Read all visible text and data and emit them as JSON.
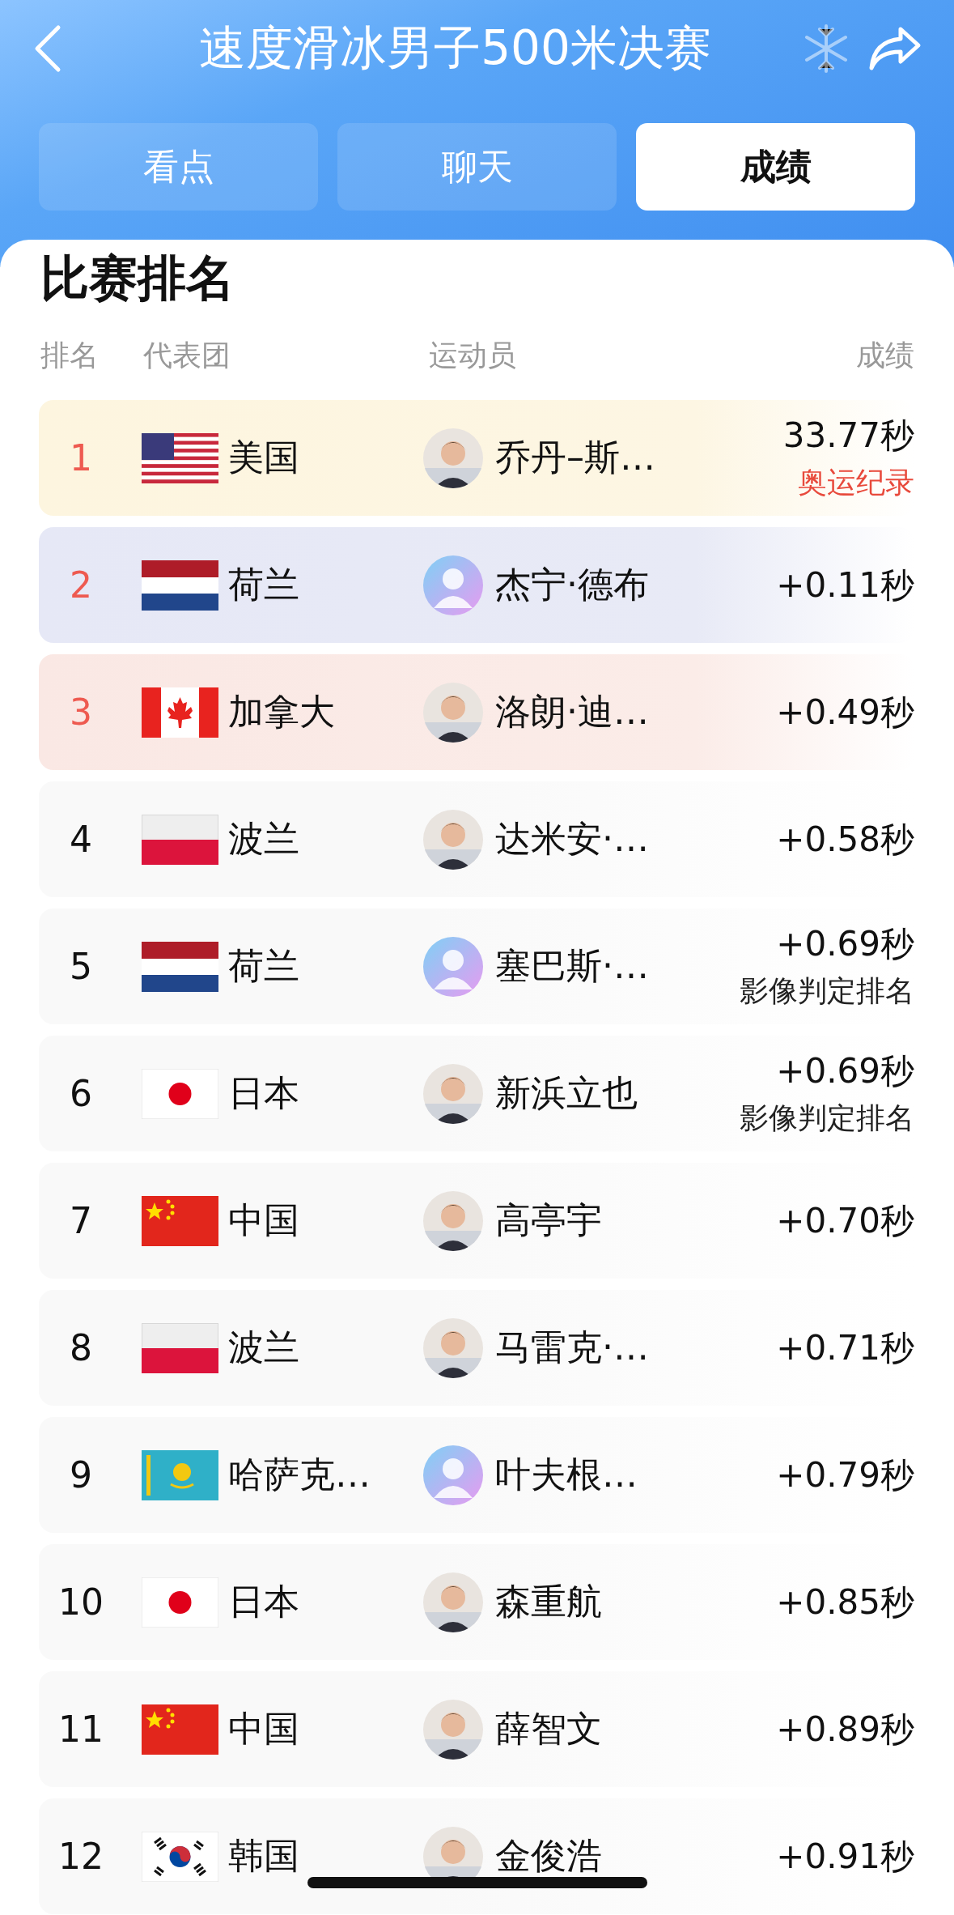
{
  "header": {
    "title": "速度滑冰男子500米决赛"
  },
  "tabs": [
    {
      "label": "看点",
      "selected": false
    },
    {
      "label": "聊天",
      "selected": false
    },
    {
      "label": "成绩",
      "selected": true
    }
  ],
  "section_title": "比赛排名",
  "columns": [
    "排名",
    "代表团",
    "运动员",
    "成绩"
  ],
  "rows": [
    {
      "rank": "1",
      "kind": "gold",
      "flag": {
        "kind": "usa"
      },
      "country": "美国",
      "athlete": "乔丹–斯…",
      "result": "33.77秒",
      "note": {
        "text": "奥运纪录",
        "kind": "record"
      }
    },
    {
      "rank": "2",
      "kind": "silver",
      "flag": {
        "kind": "netherlands"
      },
      "country": "荷兰",
      "avatar": {
        "kind": "placeholder"
      },
      "athlete": "杰宁·德布",
      "result": "+0.11秒"
    },
    {
      "rank": "3",
      "kind": "bronze",
      "flag": {
        "kind": "canada"
      },
      "country": "加拿大",
      "athlete": "洛朗·迪…",
      "result": "+0.49秒"
    },
    {
      "rank": "4",
      "kind": "plain",
      "flag": {
        "kind": "poland"
      },
      "country": "波兰",
      "athlete": "达米安·…",
      "result": "+0.58秒"
    },
    {
      "rank": "5",
      "kind": "plain",
      "flag": {
        "kind": "netherlands"
      },
      "country": "荷兰",
      "avatar": {
        "kind": "placeholder"
      },
      "athlete": "塞巴斯·…",
      "result": "+0.69秒",
      "note": {
        "text": "影像判定排名",
        "kind": "info"
      }
    },
    {
      "rank": "6",
      "kind": "plain",
      "flag": {
        "kind": "japan"
      },
      "country": "日本",
      "athlete": "新浜立也",
      "result": "+0.69秒",
      "note": {
        "text": "影像判定排名",
        "kind": "info"
      }
    },
    {
      "rank": "7",
      "kind": "plain",
      "flag": {
        "kind": "china"
      },
      "country": "中国",
      "athlete": "高亭宇",
      "result": "+0.70秒"
    },
    {
      "rank": "8",
      "kind": "plain",
      "flag": {
        "kind": "poland"
      },
      "country": "波兰",
      "athlete": "马雷克·…",
      "result": "+0.71秒"
    },
    {
      "rank": "9",
      "kind": "plain",
      "flag": {
        "kind": "kazakhstan"
      },
      "country": "哈萨克…",
      "avatar": {
        "kind": "placeholder"
      },
      "athlete": "叶夫根…",
      "result": "+0.79秒"
    },
    {
      "rank": "10",
      "kind": "plain",
      "flag": {
        "kind": "japan"
      },
      "country": "日本",
      "athlete": "森重航",
      "result": "+0.85秒"
    },
    {
      "rank": "11",
      "kind": "plain",
      "flag": {
        "kind": "china"
      },
      "country": "中国",
      "athlete": "薛智文",
      "result": "+0.89秒"
    },
    {
      "rank": "12",
      "kind": "plain",
      "flag": {
        "kind": "korea"
      },
      "country": "韩国",
      "athlete": "金俊浩",
      "result": "+0.91秒"
    }
  ]
}
